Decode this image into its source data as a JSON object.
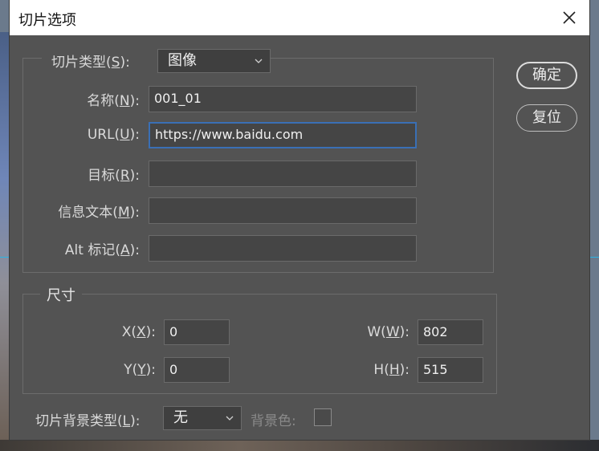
{
  "window": {
    "title": "切片选项"
  },
  "buttons": {
    "ok": "确定",
    "reset": "复位"
  },
  "slice": {
    "type_label_pre": "切片类型(",
    "type_label_key": "S",
    "type_label_post": "):",
    "type_value": "图像",
    "name_label_pre": "名称(",
    "name_label_key": "N",
    "name_label_post": "):",
    "name_value": "001_01",
    "url_label_pre": "URL(",
    "url_label_key": "U",
    "url_label_post": "):",
    "url_value": "https://www.baidu.com",
    "target_label_pre": "目标(",
    "target_label_key": "R",
    "target_label_post": "):",
    "target_value": "",
    "message_label_pre": "信息文本(",
    "message_label_key": "M",
    "message_label_post": "):",
    "message_value": "",
    "alt_label_pre": "Alt 标记(",
    "alt_label_key": "A",
    "alt_label_post": "):",
    "alt_value": ""
  },
  "dimensions": {
    "legend": "尺寸",
    "x_label_pre": "X(",
    "x_label_key": "X",
    "x_label_post": "):",
    "x_value": "0",
    "y_label_pre": "Y(",
    "y_label_key": "Y",
    "y_label_post": "):",
    "y_value": "0",
    "w_label_pre": "W(",
    "w_label_key": "W",
    "w_label_post": "):",
    "w_value": "802",
    "h_label_pre": "H(",
    "h_label_key": "H",
    "h_label_post": "):",
    "h_value": "515"
  },
  "background": {
    "type_label_pre": "切片背景类型(",
    "type_label_key": "L",
    "type_label_post": "):",
    "type_value": "无",
    "color_label": "背景色:"
  },
  "colors": {
    "dialog_bg": "#535353",
    "focus_border": "#3a6fb5",
    "guide_line": "#2bb3e6"
  }
}
